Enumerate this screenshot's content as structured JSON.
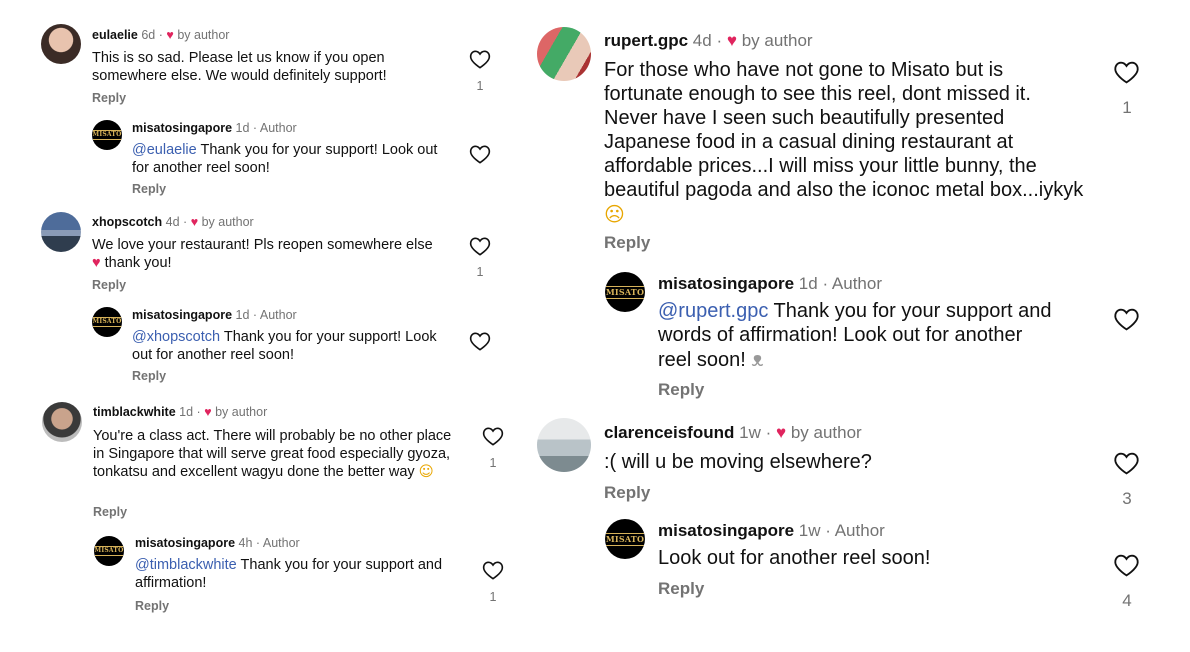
{
  "comments_left": [
    {
      "username": "eulaelie",
      "time": "6d",
      "by_author": "by author",
      "text": "This is so sad. Please let us know if you open somewhere else. We would definitely support!",
      "reply": "Reply",
      "likes": "1",
      "replies": [
        {
          "username": "misatosingapore",
          "time": "1d",
          "role": "Author",
          "mention": "@eulaelie",
          "text": " Thank you for your support! Look out for another reel soon!",
          "reply": "Reply"
        }
      ]
    },
    {
      "username": "xhopscotch",
      "time": "4d",
      "by_author": "by author",
      "text_a": "We love your restaurant! Pls reopen somewhere else ",
      "text_b": " thank you!",
      "reply": "Reply",
      "likes": "1",
      "replies": [
        {
          "username": "misatosingapore",
          "time": "1d",
          "role": "Author",
          "mention": "@xhopscotch",
          "text": " Thank you for your support! Look out for another reel soon!",
          "reply": "Reply"
        }
      ]
    },
    {
      "username": "timblackwhite",
      "time": "1d",
      "by_author": "by author",
      "text": "You're a class act. There will probably be no other place in Singapore that will serve great food especially gyoza, tonkatsu and excellent wagyu done the better way ",
      "reply": "Reply",
      "replies": [
        {
          "username": "misatosingapore",
          "time": "4h",
          "role": "Author",
          "mention": "@timblackwhite",
          "text": " Thank you for your support and affirmation!",
          "reply": "Reply",
          "likes": "1"
        }
      ]
    }
  ],
  "comments_right": [
    {
      "username": "rupert.gpc",
      "time": "4d",
      "by_author": "by author",
      "text": "For those who have not gone to Misato but is fortunate enough to see this reel, dont missed it. Never have I seen such beautifully presented Japanese food in a casual dining restaurant at affordable prices...I will miss your little bunny, the beautiful pagoda and also the iconoc metal box...iykyk",
      "reply": "Reply",
      "likes": "1",
      "replies": [
        {
          "username": "misatosingapore",
          "time": "1d",
          "role": "Author",
          "mention": "@rupert.gpc",
          "text": " Thank you for your support and words of affirmation! Look out for another reel soon! ",
          "reply": "Reply"
        }
      ]
    },
    {
      "username": "clarenceisfound",
      "time": "1w",
      "by_author": "by author",
      "text": ":( will u be moving elsewhere?",
      "reply": "Reply",
      "likes": "3",
      "replies": [
        {
          "username": "misatosingapore",
          "time": "1w",
          "role": "Author",
          "text": "Look out for another reel soon!",
          "reply": "Reply",
          "likes": "4"
        }
      ]
    }
  ],
  "separator": "·",
  "logo_text": "MISATO",
  "icons": {
    "heart_badge": "small-red-heart-icon",
    "like": "heart-outline-icon",
    "emoji_heart": "red-heart-emoji",
    "emoji_yum": "yum-face-emoji",
    "emoji_cry": "crying-face-emoji",
    "emoji_bunny": "rabbit-face-emoji"
  },
  "colors": {
    "heart": "#e0245e",
    "mention": "#3b5fb0",
    "muted": "#737373",
    "logo_gold": "#d7b35a"
  }
}
